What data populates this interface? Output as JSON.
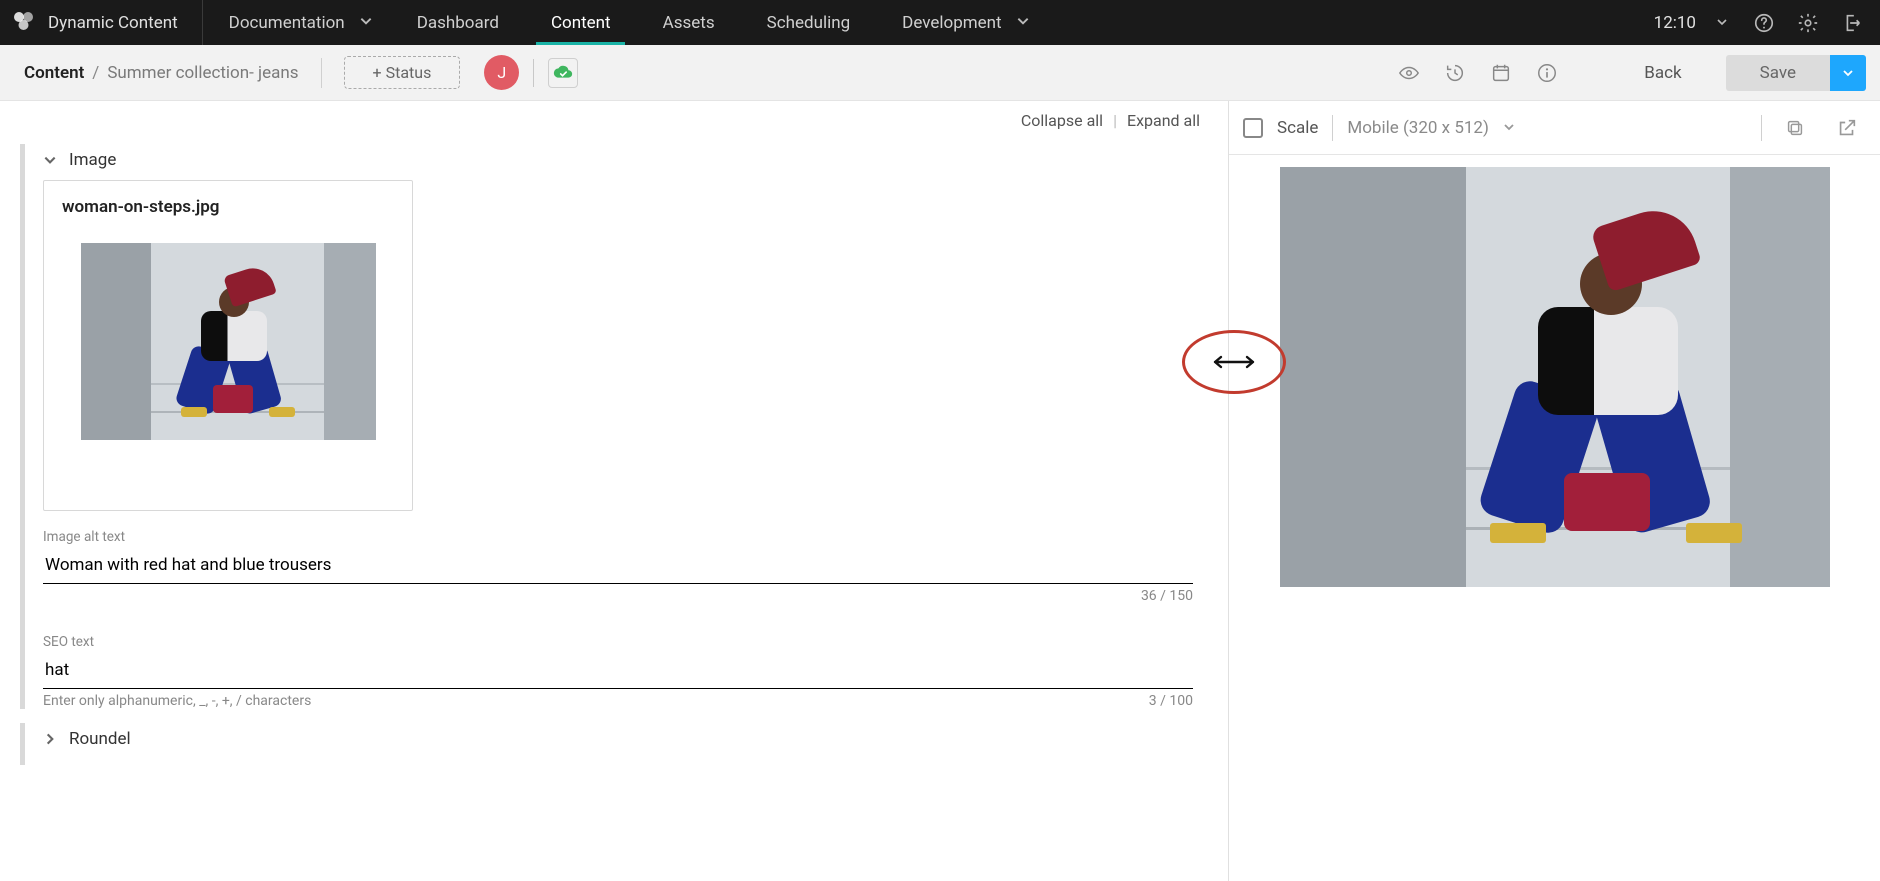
{
  "brand": {
    "title": "Dynamic Content"
  },
  "nav": {
    "items": [
      {
        "label": "Documentation",
        "caret": true
      },
      {
        "label": "Dashboard"
      },
      {
        "label": "Content",
        "active": true
      },
      {
        "label": "Assets"
      },
      {
        "label": "Scheduling"
      },
      {
        "label": "Development",
        "caret": true
      }
    ],
    "clock": "12:10"
  },
  "subbar": {
    "crumb_root": "Content",
    "crumb_sep": "/",
    "crumb_leaf": "Summer collection- jeans",
    "status_label": "+ Status",
    "avatar_initial": "J",
    "back_label": "Back",
    "save_label": "Save"
  },
  "editor": {
    "collapse_label": "Collapse all",
    "toolbar_sep": "|",
    "expand_label": "Expand all",
    "sections": {
      "image": {
        "title": "Image",
        "card_title": "woman-on-steps.jpg",
        "alt_label": "Image alt text",
        "alt_value": "Woman with red hat and blue trousers",
        "alt_counter": "36 / 150",
        "seo_label": "SEO text",
        "seo_value": "hat",
        "seo_help": "Enter only alphanumeric, _, -, +, / characters",
        "seo_counter": "3 / 100"
      },
      "roundel": {
        "title": "Roundel"
      }
    }
  },
  "preview": {
    "scale_label": "Scale",
    "device_label": "Mobile (320 x 512)"
  }
}
